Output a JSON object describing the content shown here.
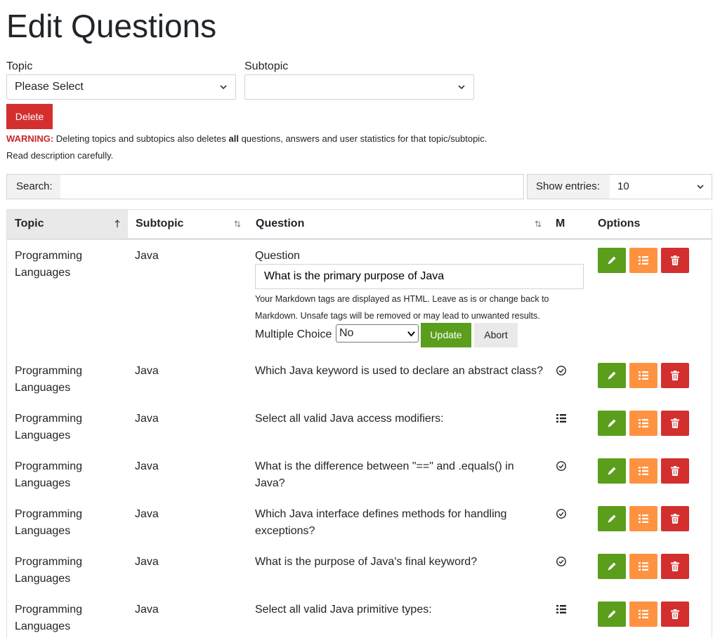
{
  "page": {
    "title": "Edit Questions"
  },
  "filters": {
    "topic_label": "Topic",
    "topic_value": "Please Select",
    "subtopic_label": "Subtopic",
    "subtopic_value": ""
  },
  "delete_button": "Delete",
  "warning": {
    "prefix": "WARNING:",
    "text1": " Deleting topics and subtopics also deletes ",
    "bold": "all",
    "text2": " questions, answers and user statistics for that topic/subtopic.",
    "read": "Read description carefully."
  },
  "search": {
    "label": "Search:",
    "value": ""
  },
  "entries": {
    "label": "Show entries:",
    "value": "10"
  },
  "table": {
    "headers": {
      "topic": "Topic",
      "subtopic": "Subtopic",
      "question": "Question",
      "m": "M",
      "options": "Options"
    },
    "edit_row": {
      "topic_line1": "Programming",
      "topic_line2": "Languages",
      "subtopic": "Java",
      "question_label": "Question",
      "question_value": "What is the primary purpose of Java",
      "hint_line1": "Your Markdown tags are displayed as HTML. Leave as is or change back to",
      "hint_line2": "Markdown. Unsafe tags will be removed or may lead to unwanted results.",
      "mc_label": "Multiple Choice",
      "mc_value": "No",
      "update": "Update",
      "abort": "Abort"
    },
    "rows": [
      {
        "topic_line1": "Programming",
        "topic_line2": "Languages",
        "subtopic": "Java",
        "q_line1": "Which Java keyword is used to declare an abstract class?",
        "q_line2": "",
        "m_icon": "check-circle-icon"
      },
      {
        "topic_line1": "Programming",
        "topic_line2": "Languages",
        "subtopic": "Java",
        "q_line1": "Select all valid Java access modifiers:",
        "q_line2": "",
        "m_icon": "list-icon"
      },
      {
        "topic_line1": "Programming",
        "topic_line2": "Languages",
        "subtopic": "Java",
        "q_line1": "What is the difference between \"==\" and .equals() in",
        "q_line2": "Java?",
        "m_icon": "check-circle-icon"
      },
      {
        "topic_line1": "Programming",
        "topic_line2": "Languages",
        "subtopic": "Java",
        "q_line1": "Which Java interface defines methods for handling",
        "q_line2": "exceptions?",
        "m_icon": "check-circle-icon"
      },
      {
        "topic_line1": "Programming",
        "topic_line2": "Languages",
        "subtopic": "Java",
        "q_line1": "What is the purpose of Java's final keyword?",
        "q_line2": "",
        "m_icon": "check-circle-icon"
      },
      {
        "topic_line1": "Programming",
        "topic_line2": "Languages",
        "subtopic": "Java",
        "q_line1": "Select all valid Java primitive types:",
        "q_line2": "",
        "m_icon": "list-icon"
      }
    ]
  },
  "colors": {
    "edit": "#5a9e1c",
    "list": "#ff9240",
    "delete": "#d32f2f",
    "warning": "#c62828"
  }
}
